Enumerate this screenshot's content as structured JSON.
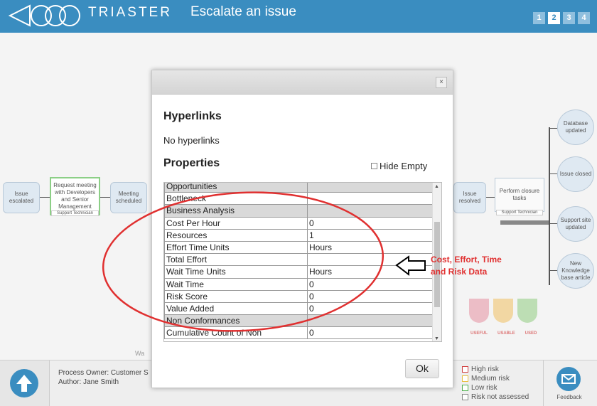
{
  "header": {
    "brand": "TRIASTER",
    "title": "Escalate an issue",
    "steps": [
      "1",
      "2",
      "3",
      "4"
    ]
  },
  "process_map": {
    "nodes": {
      "issue_escalated": "Issue escalated",
      "request_meeting": "Request meeting with Developers and Senior Management",
      "request_meeting_role": "Support Technician",
      "meeting_scheduled": "Meeting scheduled",
      "issue_resolved": "Issue resolved",
      "perform_closure": "Perform closure tasks",
      "perform_closure_role": "Support Technician",
      "database_updated": "Database updated",
      "issue_closed": "Issue closed",
      "support_site_updated": "Support site updated",
      "new_kb_article": "New Knowledge base article"
    },
    "partial_label": "Wa"
  },
  "dialog": {
    "hyperlinks_heading": "Hyperlinks",
    "hyperlinks_value": "No hyperlinks",
    "properties_heading": "Properties",
    "hide_empty_label": "Hide Empty",
    "ok_label": "Ok",
    "close_label": "×",
    "rows": [
      {
        "key": "Opportunities",
        "value": "",
        "section": true
      },
      {
        "key": "Bottleneck",
        "value": "",
        "section": false
      },
      {
        "key": "Business Analysis",
        "value": "",
        "section": true
      },
      {
        "key": "Cost Per Hour",
        "value": "0",
        "section": false
      },
      {
        "key": "Resources",
        "value": "1",
        "section": false
      },
      {
        "key": "Effort Time Units",
        "value": "Hours",
        "section": false
      },
      {
        "key": "Total Effort",
        "value": "",
        "section": false
      },
      {
        "key": "Wait Time Units",
        "value": "Hours",
        "section": false
      },
      {
        "key": "Wait Time",
        "value": "0",
        "section": false
      },
      {
        "key": "Risk Score",
        "value": "0",
        "section": false
      },
      {
        "key": "Value Added",
        "value": "0",
        "section": false
      },
      {
        "key": "Non Conformances",
        "value": "",
        "section": true
      },
      {
        "key": "Cumulative Count of Non",
        "value": "0",
        "section": false
      }
    ]
  },
  "annotation": {
    "line1": "Cost, Effort, Time",
    "line2": "and Risk Data",
    "color": "#e03030"
  },
  "footer": {
    "owner": "Process Owner: Customer S",
    "author": "Author: Jane Smith",
    "legend": [
      {
        "label": "High risk",
        "color": "#d04040"
      },
      {
        "label": "Medium risk",
        "color": "#e8c040"
      },
      {
        "label": "Low risk",
        "color": "#50b050"
      },
      {
        "label": "Risk not assessed",
        "color": "#888888"
      }
    ],
    "feedback_label": "Feedback",
    "usefulness": [
      "USEFUL",
      "USABLE",
      "USED"
    ]
  }
}
